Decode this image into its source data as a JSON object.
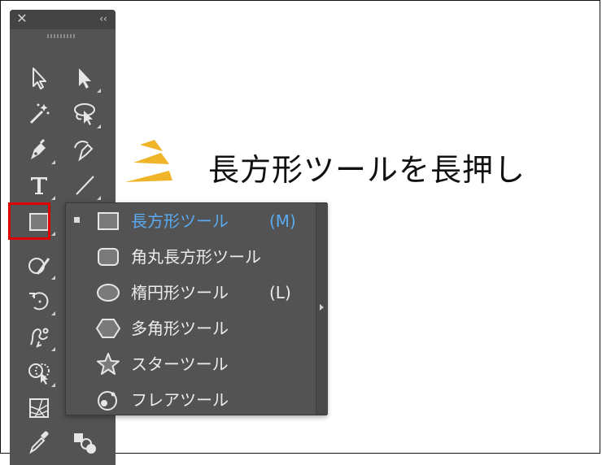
{
  "window": {
    "close_icon": "close-icon",
    "collapse_label": "‹‹"
  },
  "toolbar": {
    "tools": [
      {
        "name": "selection-tool",
        "icon": "selection-arrow-icon"
      },
      {
        "name": "direct-selection-tool",
        "icon": "direct-selection-arrow-icon"
      },
      {
        "name": "magic-wand-tool",
        "icon": "magic-wand-icon"
      },
      {
        "name": "lasso-tool",
        "icon": "lasso-icon"
      },
      {
        "name": "pen-tool",
        "icon": "pen-icon"
      },
      {
        "name": "curvature-tool",
        "icon": "curvature-pen-icon"
      },
      {
        "name": "type-tool",
        "icon": "type-icon"
      },
      {
        "name": "line-segment-tool",
        "icon": "line-icon"
      },
      {
        "name": "rectangle-tool",
        "icon": "rectangle-icon"
      },
      {
        "name": "shaper-tool",
        "icon": "shaper-icon"
      },
      {
        "name": "rotate-tool",
        "icon": "rotate-icon"
      },
      {
        "name": "warp-tool",
        "icon": "warp-icon"
      },
      {
        "name": "shape-builder-tool",
        "icon": "shape-builder-icon"
      },
      {
        "name": "perspective-grid-tool",
        "icon": "perspective-grid-icon"
      },
      {
        "name": "eyedropper-tool",
        "icon": "eyedropper-icon"
      },
      {
        "name": "blend-tool",
        "icon": "blend-icon"
      }
    ],
    "selected_highlight_color": "#e00000"
  },
  "flyout": {
    "items": [
      {
        "label": "長方形ツール",
        "shortcut": "(M)",
        "active": true,
        "icon": "rectangle-icon"
      },
      {
        "label": "角丸長方形ツール",
        "shortcut": "",
        "active": false,
        "icon": "rounded-rectangle-icon"
      },
      {
        "label": "楕円形ツール",
        "shortcut": "(L)",
        "active": false,
        "icon": "ellipse-icon"
      },
      {
        "label": "多角形ツール",
        "shortcut": "",
        "active": false,
        "icon": "polygon-icon"
      },
      {
        "label": "スターツール",
        "shortcut": "",
        "active": false,
        "icon": "star-icon"
      },
      {
        "label": "フレアツール",
        "shortcut": "",
        "active": false,
        "icon": "flare-icon"
      }
    ],
    "active_color": "#5aaaf0"
  },
  "annotation": {
    "caption": "長方形ツールを長押し",
    "burst_color": "#f0b429"
  }
}
